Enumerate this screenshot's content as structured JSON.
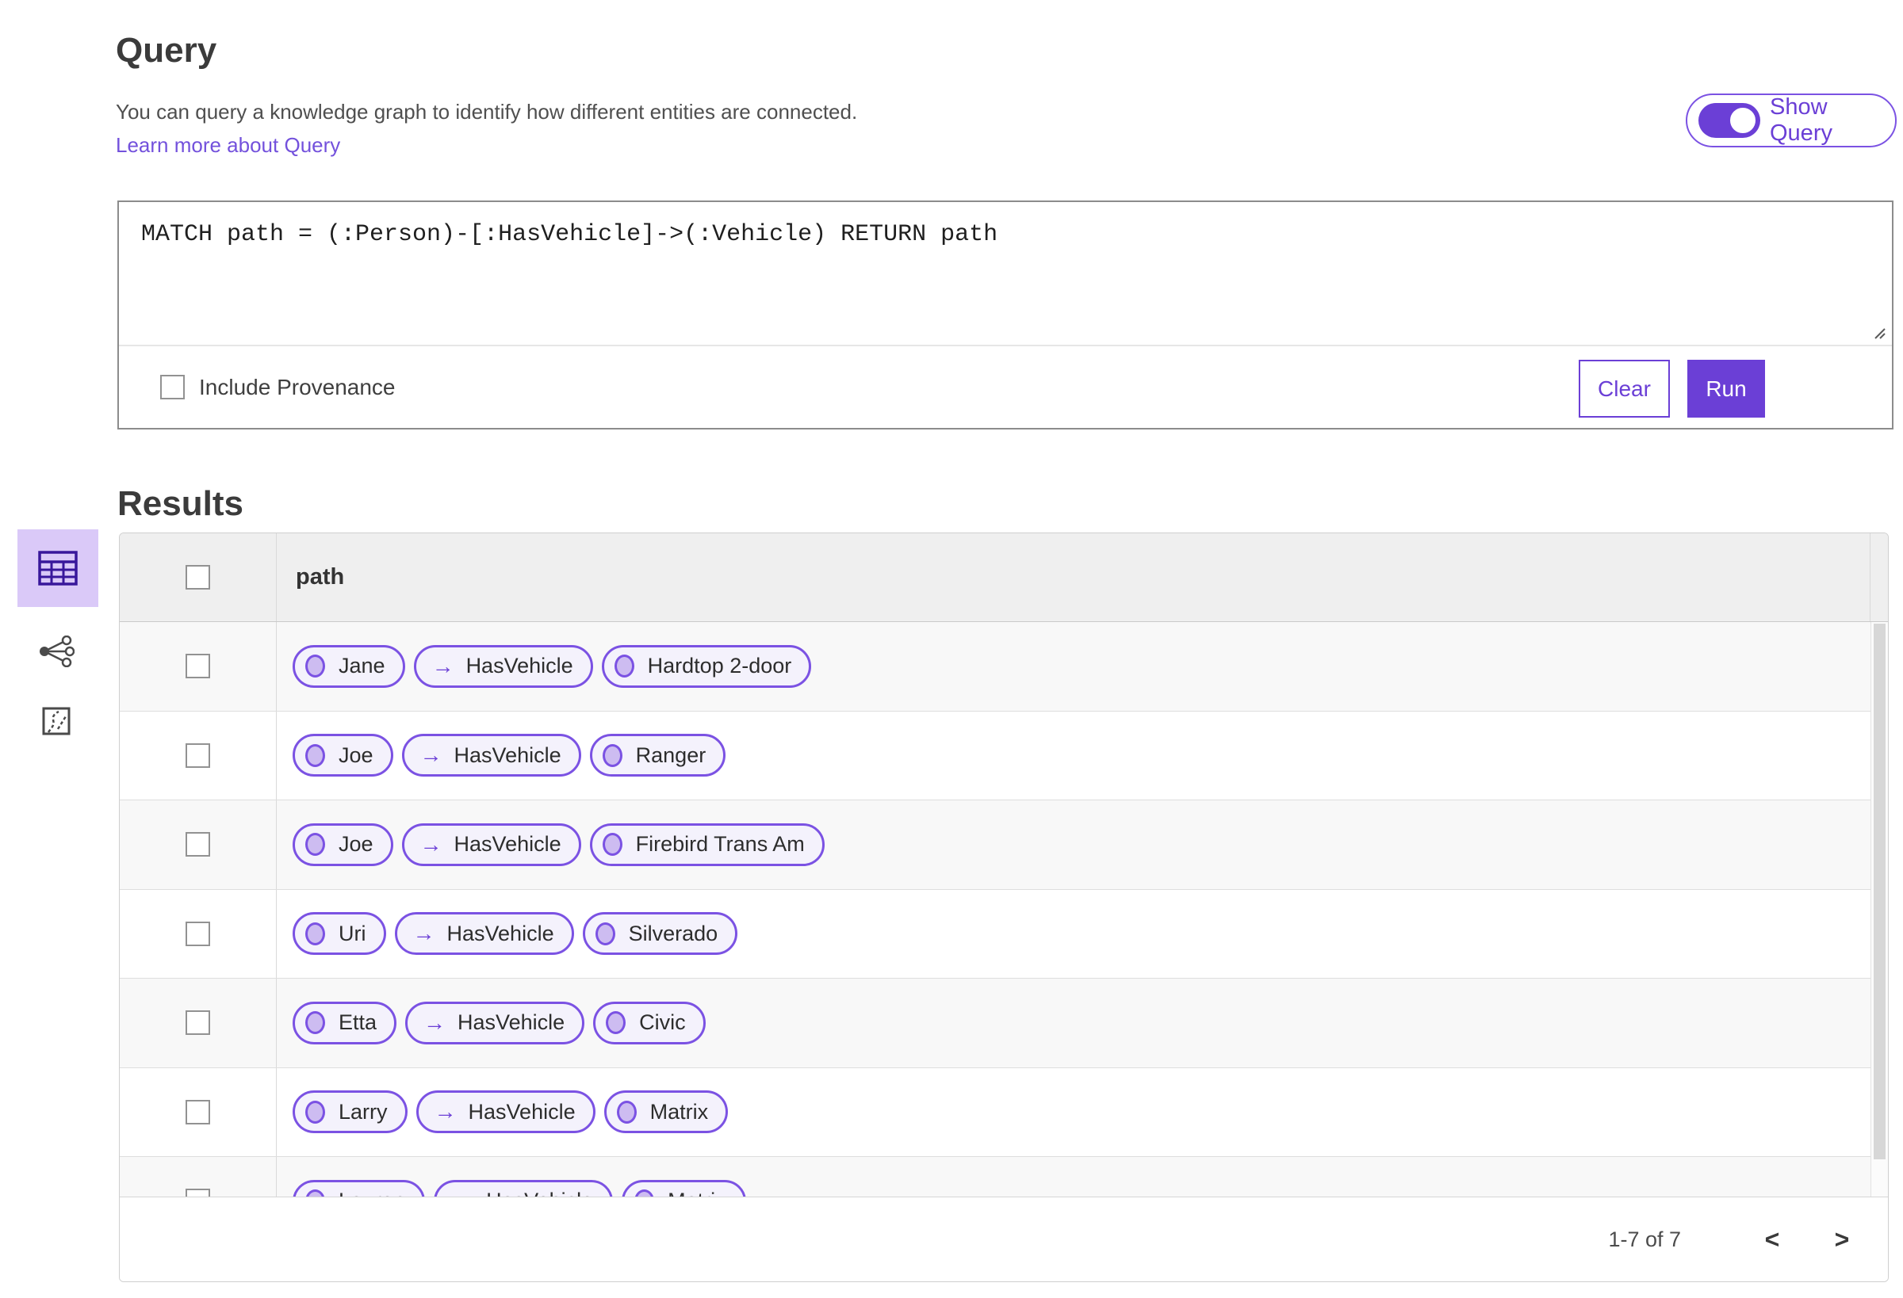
{
  "header": {
    "title": "Query",
    "description": "You can query a knowledge graph to identify how different entities are connected.",
    "learn_more_label": "Learn more about Query",
    "show_query_label": "Show Query",
    "show_query_state": "on"
  },
  "query_editor": {
    "query_text": "MATCH path = (:Person)-[:HasVehicle]->(:Vehicle) RETURN path",
    "include_provenance_label": "Include Provenance",
    "include_provenance_checked": false,
    "clear_label": "Clear",
    "run_label": "Run"
  },
  "results": {
    "title": "Results",
    "views": [
      {
        "name": "table-view",
        "selected": true
      },
      {
        "name": "link-chart-view",
        "selected": false
      },
      {
        "name": "map-view",
        "selected": false
      }
    ],
    "column_header": "path",
    "select_all_checked": false,
    "rows": [
      {
        "entity1": "Jane",
        "relationship": "HasVehicle",
        "entity2": "Hardtop 2-door"
      },
      {
        "entity1": "Joe",
        "relationship": "HasVehicle",
        "entity2": "Ranger"
      },
      {
        "entity1": "Joe",
        "relationship": "HasVehicle",
        "entity2": "Firebird Trans Am"
      },
      {
        "entity1": "Uri",
        "relationship": "HasVehicle",
        "entity2": "Silverado"
      },
      {
        "entity1": "Etta",
        "relationship": "HasVehicle",
        "entity2": "Civic"
      },
      {
        "entity1": "Larry",
        "relationship": "HasVehicle",
        "entity2": "Matrix"
      },
      {
        "entity1": "Lauren",
        "relationship": "HasVehicle",
        "entity2": "Matrix"
      }
    ],
    "pagination": {
      "range_label": "1-7 of 7",
      "prev_icon": "<",
      "next_icon": ">"
    }
  },
  "icons": {
    "arrow_right": "→"
  },
  "colors": {
    "accent": "#6b3fd6",
    "accent2": "#7351dc",
    "pill_border": "#7b52e3",
    "pill_bg": "#f4f2fc",
    "node_fill": "#cdbcf1",
    "selected_view_bg": "#dac9f8"
  }
}
